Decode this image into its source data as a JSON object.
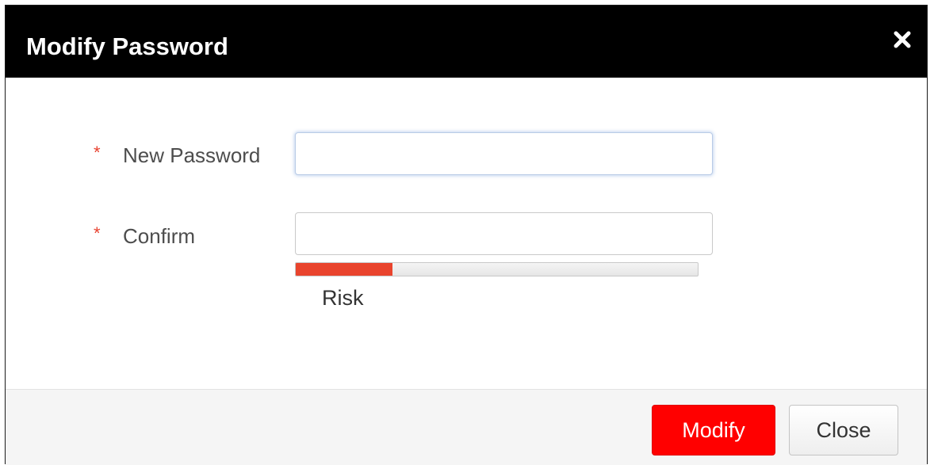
{
  "dialog": {
    "title": "Modify Password",
    "close_icon": "close-icon"
  },
  "form": {
    "required_marker": "*",
    "new_password": {
      "label": "New Password",
      "value": "",
      "placeholder": ""
    },
    "confirm": {
      "label": "Confirm",
      "value": "",
      "placeholder": ""
    },
    "strength": {
      "label": "Risk",
      "level_fraction": 0.24,
      "color": "#e9442d"
    }
  },
  "footer": {
    "modify_label": "Modify",
    "close_label": "Close"
  },
  "colors": {
    "titlebar": "#000000",
    "primary_button": "#ff0000",
    "required_marker": "#e8412f"
  }
}
